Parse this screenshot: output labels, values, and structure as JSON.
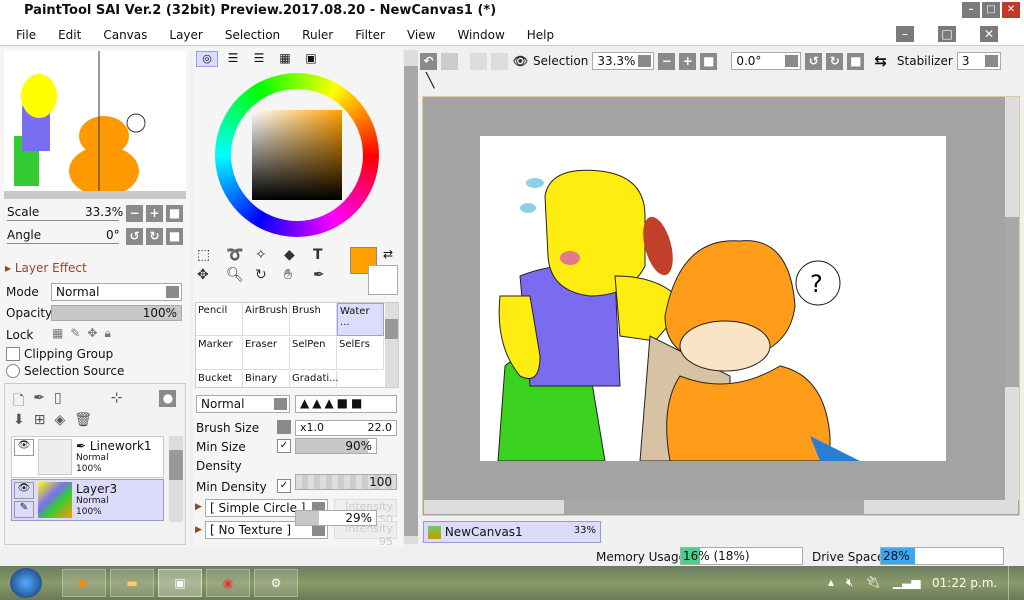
{
  "title": "PaintTool SAI Ver.2 (32bit) Preview.2017.08.20 - NewCanvas1 (*)",
  "menu": [
    "File",
    "Edit",
    "Canvas",
    "Layer",
    "Selection",
    "Ruler",
    "Filter",
    "View",
    "Window",
    "Help"
  ],
  "navigator": {
    "scale_label": "Scale",
    "scale_value": "33.3%",
    "angle_label": "Angle",
    "angle_value": "0°"
  },
  "layer_effect": {
    "label": "Layer Effect",
    "mode_label": "Mode",
    "mode_value": "Normal",
    "opacity_label": "Opacity",
    "opacity_value": "100%",
    "opacity_fraction": 1.0,
    "lock_label": "Lock",
    "clipping_label": "Clipping Group",
    "selection_source_label": "Selection Source"
  },
  "layers": [
    {
      "name": "Linework1",
      "mode": "Normal",
      "opacity": "100%"
    },
    {
      "name": "Layer3",
      "mode": "Normal",
      "opacity": "100%",
      "selected": true
    }
  ],
  "tools": {
    "brushes": [
      "Pencil",
      "AirBrush",
      "Brush",
      "Water ...",
      "Marker",
      "Eraser",
      "SelPen",
      "SelErs",
      "Bucket",
      "Binary ...",
      "Gradati..."
    ],
    "selected_brush": "Water ..."
  },
  "brush_settings": {
    "blend_mode": "Normal",
    "size_label": "Brush Size",
    "size_mult": "x1.0",
    "size_value": "22.0",
    "min_size_label": "Min Size",
    "min_size_value": "90%",
    "min_size_fraction": 0.9,
    "density_label": "Density",
    "density_value": "100",
    "min_density_label": "Min Density",
    "min_density_value": "29%",
    "min_density_fraction": 0.29,
    "shape": "[ Simple Circle ]",
    "shape_intensity": "Intensity 50",
    "texture": "[ No Texture ]",
    "texture_intensity": "Intensity 95"
  },
  "colors": {
    "primary": "#ffa000",
    "secondary": "#ffffff",
    "accent": "#dcdcff"
  },
  "toolbar": {
    "selection_label": "Selection",
    "zoom": "33.3%",
    "rotation": "0.0°",
    "stabilizer_label": "Stabilizer",
    "stabilizer_value": "3"
  },
  "canvas_tab": {
    "name": "NewCanvas1",
    "zoom": "33%"
  },
  "status": {
    "memory_label": "Memory Usage",
    "memory_value": "16% (18%)",
    "memory_fraction": 0.16,
    "drive_label": "Drive Space",
    "drive_value": "28%",
    "drive_fraction": 0.28
  },
  "taskbar": {
    "time": "01:22 p.m."
  }
}
